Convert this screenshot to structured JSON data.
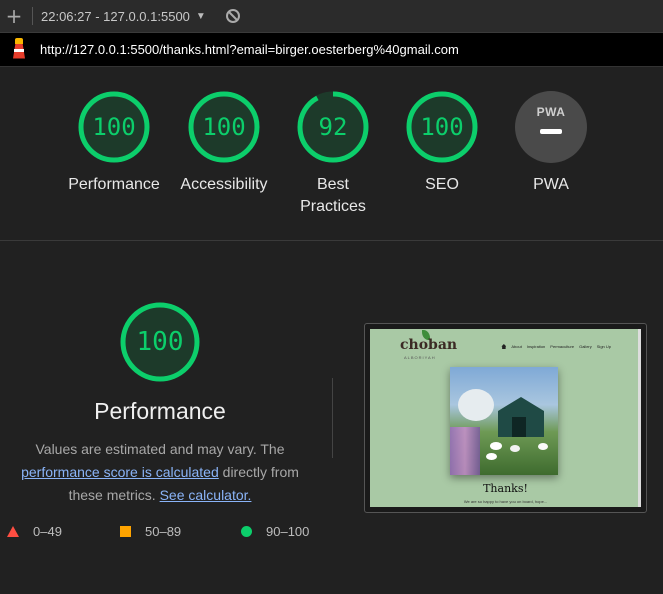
{
  "toolbar": {
    "add_label": "+",
    "report_label": "22:06:27 - 127.0.0.1:5500",
    "caret": "▼"
  },
  "urlbar": {
    "url": "http://127.0.0.1:5500/thanks.html?email=birger.oesterberg%40gmail.com"
  },
  "gauges": [
    {
      "label": "Performance",
      "score": "100",
      "fraction": 1.0
    },
    {
      "label": "Accessibility",
      "score": "100",
      "fraction": 1.0
    },
    {
      "label_line1": "Best",
      "label_line2": "Practices",
      "score": "92",
      "fraction": 0.92
    },
    {
      "label": "SEO",
      "score": "100",
      "fraction": 1.0
    },
    {
      "label": "PWA",
      "badge": "PWA"
    }
  ],
  "performance": {
    "score": "100",
    "fraction": 1.0,
    "title": "Performance",
    "desc_1": "Values are estimated and may vary. The ",
    "link_1": "performance score is calculated",
    "desc_2": " directly from these metrics. ",
    "link_2": "See calculator."
  },
  "legend": {
    "fail": "0–49",
    "average": "50–89",
    "pass": "90–100"
  },
  "thumbnail": {
    "logo": "choban",
    "logo_sub": "ALBORIYAH",
    "nav": [
      "About",
      "Inspiration",
      "Permaculture",
      "Gallery",
      "Sign Up"
    ],
    "heading": "Thanks!",
    "subtext": "We are so happy to have you on board, hope..."
  },
  "colors": {
    "pass": "#0cce6b",
    "average": "#ffa400",
    "fail": "#ff4e42",
    "background": "#212121"
  }
}
